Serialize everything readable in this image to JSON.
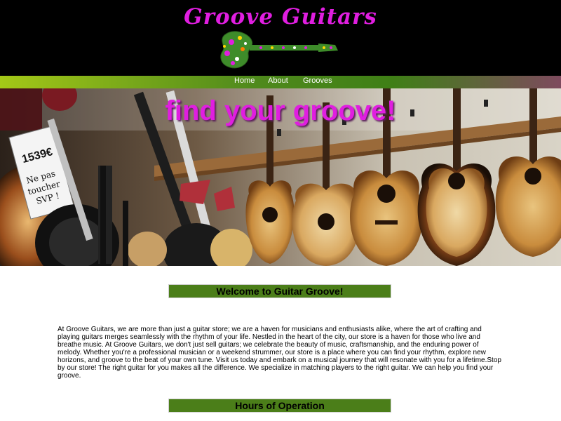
{
  "brand": {
    "logo_text": "Groove Guitars",
    "accent_color": "#e01ee0",
    "header_bg": "#000000"
  },
  "nav": {
    "items": [
      {
        "label": "Home"
      },
      {
        "label": "About"
      },
      {
        "label": "Grooves"
      }
    ]
  },
  "hero": {
    "title": "find your groove!",
    "sign_text": "Ne pas toucher SVP !",
    "price_tag": "1539€"
  },
  "welcome": {
    "heading": "Welcome to Guitar Groove!",
    "paragraph": "At Groove Guitars, we are more than just a guitar store; we are a haven for musicians and enthusiasts alike, where the art of crafting and playing guitars merges seamlessly with the rhythm of your life. Nestled in the heart of the city, our store is a haven for those who live and breathe music. At Groove Guitars, we don't just sell guitars; we celebrate the beauty of music, craftsmanship, and the enduring power of melody. Whether you're a professional musician or a weekend strummer, our store is a place where you can find your rhythm, explore new horizons, and groove to the beat of your own tune. Visit us today and embark on a musical journey that will resonate with you for a lifetime.Stop by our store! The right guitar for you makes all the difference. We specialize in matching players to the right guitar. We can help you find your groove."
  },
  "hours": {
    "heading": "Hours of Operation"
  },
  "colors": {
    "section_bar": "#4b7e19",
    "nav_start": "#a4c817",
    "nav_end": "#7e4a5e"
  }
}
